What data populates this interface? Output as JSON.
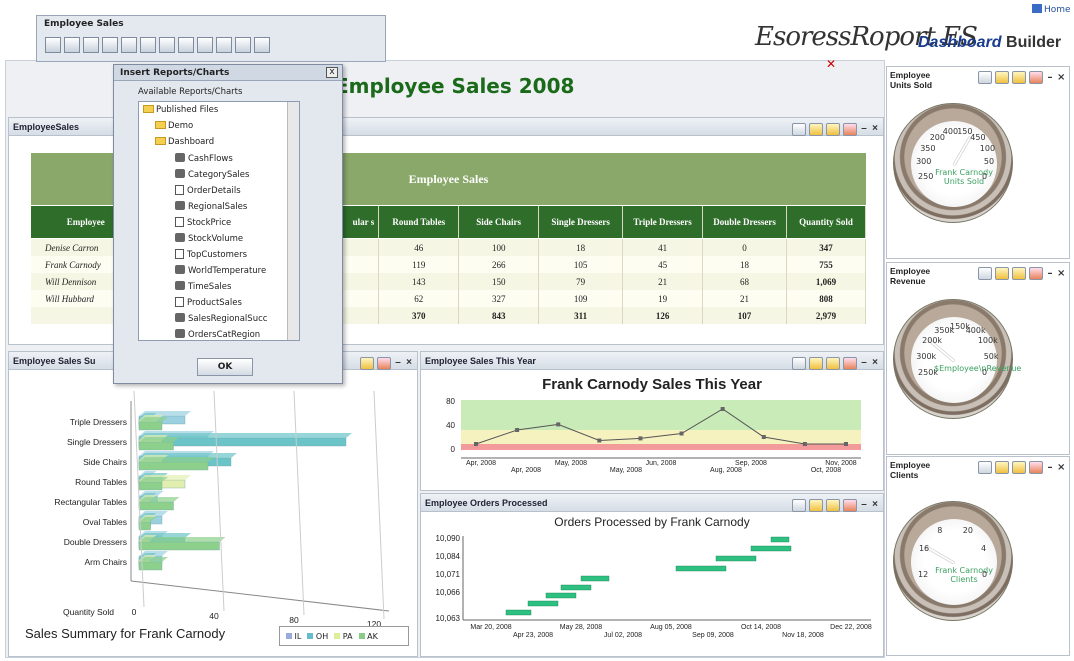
{
  "header": {
    "brand": "EsoressRoport ES",
    "builder_prefix": "Dashboard",
    "builder_suffix": "Builder",
    "home": "Home"
  },
  "toolbar": {
    "title": "Employee Sales"
  },
  "dashboard": {
    "title": "Employee Sales 2008"
  },
  "dialog": {
    "title": "Insert Reports/Charts",
    "label": "Available Reports/Charts",
    "close": "x",
    "ok": "OK",
    "tree": [
      "Published Files",
      "Demo",
      "Dashboard",
      "CashFlows",
      "CategorySales",
      "OrderDetails",
      "RegionalSales",
      "StockPrice",
      "StockVolume",
      "TopCustomers",
      "WorldTemperature",
      "TimeSales",
      "ProductSales",
      "SalesRegionalSucc",
      "OrdersCatRegion"
    ]
  },
  "employee_sales": {
    "panel_title": "EmployeeSales",
    "table_title": "Employee Sales",
    "headers": [
      "Employee",
      "ular s",
      "Round Tables",
      "Side Chairs",
      "Single Dressers",
      "Triple Dressers",
      "Double Dressers",
      "Quantity Sold"
    ],
    "rows": [
      [
        "Denise Carron",
        "46",
        "100",
        "18",
        "41",
        "0",
        "347"
      ],
      [
        "Frank Carnody",
        "119",
        "266",
        "105",
        "45",
        "18",
        "755"
      ],
      [
        "Will Dennison",
        "143",
        "150",
        "79",
        "21",
        "68",
        "1,069"
      ],
      [
        "Will Hubbard",
        "62",
        "327",
        "109",
        "19",
        "21",
        "808"
      ],
      [
        "",
        "370",
        "843",
        "311",
        "126",
        "107",
        "2,979"
      ]
    ]
  },
  "summary": {
    "panel_title": "Employee Sales Su",
    "chart_title": "Sales Summary for Frank Carnody",
    "xlabel": "Quantity Sold",
    "categories": [
      "Triple Dressers",
      "Single Dressers",
      "Side Chairs",
      "Round Tables",
      "Rectangular Tables",
      "Oval Tables",
      "Double Dressers",
      "Arm Chairs"
    ],
    "ticks": [
      "0",
      "40",
      "80",
      "120"
    ],
    "legend": [
      "IL",
      "OH",
      "PA",
      "AK"
    ]
  },
  "thisyear": {
    "panel_title": "Employee Sales This Year",
    "chart_title": "Frank Carnody Sales This Year",
    "y_ticks": [
      "80",
      "40",
      "0"
    ],
    "x_top": [
      "Apr, 2008",
      "May, 2008",
      "Jun, 2008",
      "Sep, 2008",
      "Nov, 2008"
    ],
    "x_bottom": [
      "Apr, 2008",
      "May, 2008",
      "Aug, 2008",
      "Oct, 2008"
    ]
  },
  "orders": {
    "panel_title": "Employee Orders Processed",
    "chart_title": "Orders Processed by Frank Carnody",
    "y_ticks": [
      "10,090",
      "10,084",
      "10,071",
      "10,066",
      "10,063"
    ],
    "x_top": [
      "Mar 20, 2008",
      "May 28, 2008",
      "Aug 05, 2008",
      "Oct 14, 2008",
      "Dec 22, 2008"
    ],
    "x_bottom": [
      "Apr 23, 2008",
      "Jul 02, 2008",
      "Sep 09, 2008",
      "Nov 18, 2008"
    ]
  },
  "gauges": [
    {
      "title1": "Employee",
      "title2": "Units Sold",
      "caption": "Frank Carnody Units Sold",
      "ticks": [
        "250",
        "300",
        "350",
        "200",
        "400",
        "150",
        "450",
        "100",
        "50",
        "0"
      ]
    },
    {
      "title1": "Employee",
      "title2": "Revenue",
      "caption": "$Employee\\nRevenue",
      "ticks": [
        "250k",
        "300k",
        "200k",
        "350k",
        "150k",
        "400k",
        "100k",
        "50k",
        "0"
      ]
    },
    {
      "title1": "Employee",
      "title2": "Clients",
      "caption": "Frank Carnody Clients",
      "ticks": [
        "12",
        "16",
        "8",
        "20",
        "4",
        "0"
      ]
    }
  ],
  "chart_data": [
    {
      "type": "bar",
      "title": "Sales Summary for Frank Carnody",
      "xlabel": "Quantity Sold",
      "categories": [
        "Triple Dressers",
        "Single Dressers",
        "Side Chairs",
        "Round Tables",
        "Rectangular Tables",
        "Oval Tables",
        "Double Dressers",
        "Arm Chairs"
      ],
      "series": [
        {
          "name": "IL",
          "values": [
            20,
            30,
            30,
            5,
            8,
            10,
            10,
            10
          ]
        },
        {
          "name": "OH",
          "values": [
            5,
            90,
            40,
            10,
            5,
            5,
            20,
            5
          ]
        },
        {
          "name": "PA",
          "values": [
            8,
            10,
            10,
            20,
            5,
            5,
            5,
            5
          ]
        },
        {
          "name": "AK",
          "values": [
            10,
            15,
            30,
            10,
            15,
            5,
            35,
            10
          ]
        }
      ],
      "xlim": [
        0,
        120
      ]
    },
    {
      "type": "line",
      "title": "Frank Carnody Sales This Year",
      "x": [
        "Apr, 2008",
        "",
        "May, 2008",
        "",
        "Jun, 2008",
        "",
        "Aug, 2008",
        "Sep, 2008",
        "Oct, 2008",
        "Nov, 2008"
      ],
      "y": [
        20,
        40,
        48,
        25,
        28,
        35,
        70,
        30,
        20,
        20
      ],
      "ylim": [
        0,
        80
      ]
    },
    {
      "type": "bar",
      "title": "Orders Processed by Frank Carnody",
      "categories": [
        "10,063",
        "10,066",
        "10,071",
        "10,084",
        "10,090"
      ]
    }
  ],
  "colors": {
    "accent": "#1a6a1a",
    "table_head": "#2f6d2a",
    "table_band": "#8aa86a"
  }
}
